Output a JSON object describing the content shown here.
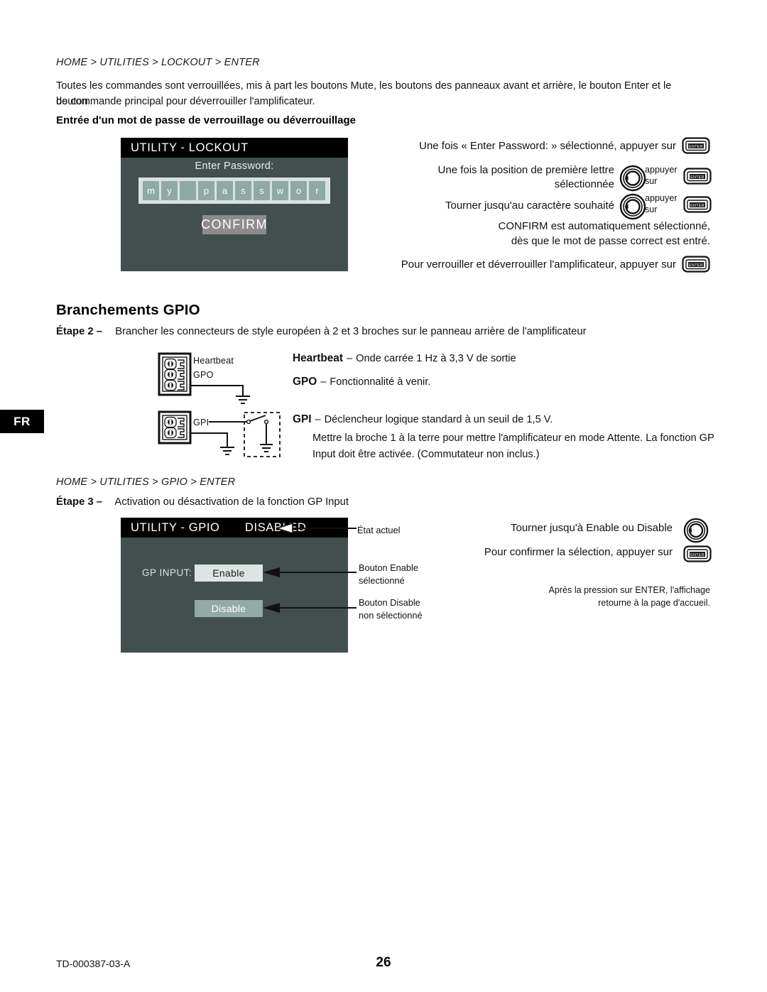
{
  "page": {
    "footer_code": "TD-000387-03-A",
    "page_number": "26",
    "language_tab": "FR",
    "colors": {
      "lcd_background": "#41504e",
      "lcd_titlebar": "#000000",
      "password_strip": "#d8e2e0",
      "password_cell": "#8fa9a5",
      "confirm_button": "#8c8c8c",
      "button_selected": "#dde5e3",
      "button_unselected": "#93aaa6"
    }
  },
  "lockout_section": {
    "breadcrumb": "HOME > UTILITIES > LOCKOUT > ENTER",
    "intro_line1": "Toutes les commandes sont verrouillées, mis à part les boutons Mute, les boutons des panneaux avant et arrière, le bouton Enter et le bouton",
    "intro_line2": "de commande principal pour déverrouiller l'amplificateur.",
    "subheading": "Entrée d'un mot de passe de verrouillage ou déverrouillage",
    "lcd": {
      "title": "UTILITY - LOCKOUT",
      "prompt": "Enter Password:",
      "password_cells": [
        "m",
        "y",
        "",
        "p",
        "a",
        "s",
        "s",
        "w",
        "o",
        "r"
      ],
      "confirm_label": "CONFIRM"
    },
    "instructions": [
      {
        "text": "Une fois « Enter Password: » sélectionné, appuyer sur",
        "icon": "enter-key-icon"
      },
      {
        "line1": "Une fois la position de première lettre",
        "line2": "sélectionnée",
        "knob": "rotary-knob-icon",
        "mid1": "appuyer",
        "mid2": "sur",
        "icon": "enter-key-icon"
      },
      {
        "text": "Tourner jusqu'au caractère souhaité",
        "knob": "rotary-knob-icon",
        "mid1": "appuyer",
        "mid2": "sur",
        "icon": "enter-key-icon"
      },
      {
        "line1": "CONFIRM est automatiquement sélectionné,",
        "line2": "dès que le mot de passe correct est entré."
      },
      {
        "text": "Pour verrouiller et déverrouiller l'amplificateur, appuyer sur",
        "icon": "enter-key-icon"
      }
    ]
  },
  "gpio_section": {
    "title": "Branchements GPIO",
    "step2_label": "Étape 2 –",
    "step2_text": "Brancher les connecteurs de style européen à 2 et 3 broches sur le panneau arrière de l'amplificateur",
    "connector_labels": {
      "heartbeat": "Heartbeat",
      "gpo": "GPO",
      "gpi": "GPI"
    },
    "descriptions": [
      {
        "term": "Heartbeat",
        "dash": "–",
        "text": "Onde carrée 1 Hz à 3,3 V de sortie"
      },
      {
        "term": "GPO",
        "dash": "–",
        "text": "Fonctionnalité à venir."
      },
      {
        "term": "GPI",
        "dash": "–",
        "text": "Déclencheur logique standard à un seuil de 1,5 V."
      }
    ],
    "gpi_detail_line1": "Mettre la broche 1 à la terre pour mettre l'amplificateur en mode Attente. La fonction GP",
    "gpi_detail_line2": "Input doit être activée. (Commutateur non inclus.)"
  },
  "gpio_enable_section": {
    "breadcrumb": "HOME > UTILITIES > GPIO > ENTER",
    "step3_label": "Étape 3 –",
    "step3_text": "Activation ou désactivation de la fonction GP Input",
    "lcd": {
      "title": "UTILITY - GPIO",
      "state": "DISABLED",
      "input_label": "GP INPUT:",
      "enable_label": "Enable",
      "disable_label": "Disable"
    },
    "callouts": [
      {
        "text": "État actuel"
      },
      {
        "line1": "Bouton Enable",
        "line2": "sélectionné"
      },
      {
        "line1": "Bouton Disable",
        "line2": "non sélectionné"
      }
    ],
    "instructions": [
      {
        "text": "Tourner jusqu'à Enable ou Disable",
        "icon": "rotary-knob-icon"
      },
      {
        "text": "Pour confirmer la sélection, appuyer sur",
        "icon": "enter-key-icon"
      }
    ],
    "note_line1": "Après la pression sur ENTER, l'affichage",
    "note_line2": "retourne à la page d'accueil."
  }
}
